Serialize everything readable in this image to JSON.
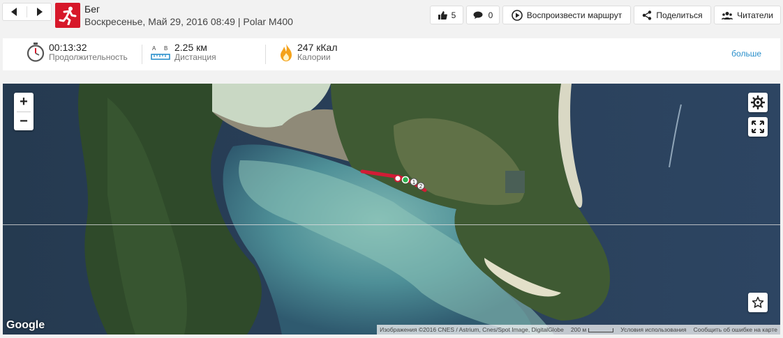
{
  "header": {
    "sport": "Бег",
    "session_info": "Воскресенье, Май 29, 2016 08:49 | Polar M400",
    "likes_count": "5",
    "comments_count": "0",
    "replay_label": "Воспроизвести маршрут",
    "share_label": "Поделиться",
    "readers_label": "Читатели"
  },
  "summary": {
    "duration_value": "00:13:32",
    "duration_label": "Продолжительность",
    "distance_value": "2.25 км",
    "distance_label": "Дистанция",
    "distance_icon_a": "A",
    "distance_icon_b": "B",
    "calories_value": "247 кКал",
    "calories_label": "Калории",
    "more_label": "больше"
  },
  "map": {
    "zoom_in": "+",
    "zoom_out": "−",
    "logo": "Google",
    "attribution": "Изображения ©2016 CNES / Astrium, Cnes/Spot Image, DigitalGlobe",
    "scale": "200 м",
    "terms": "Условия использования",
    "report": "Сообщить об ошибке на карте",
    "markers": [
      "1",
      "2"
    ]
  },
  "colors": {
    "brand_red": "#d7182a",
    "link_blue": "#2a8fcb",
    "route_red": "#d21c35"
  }
}
